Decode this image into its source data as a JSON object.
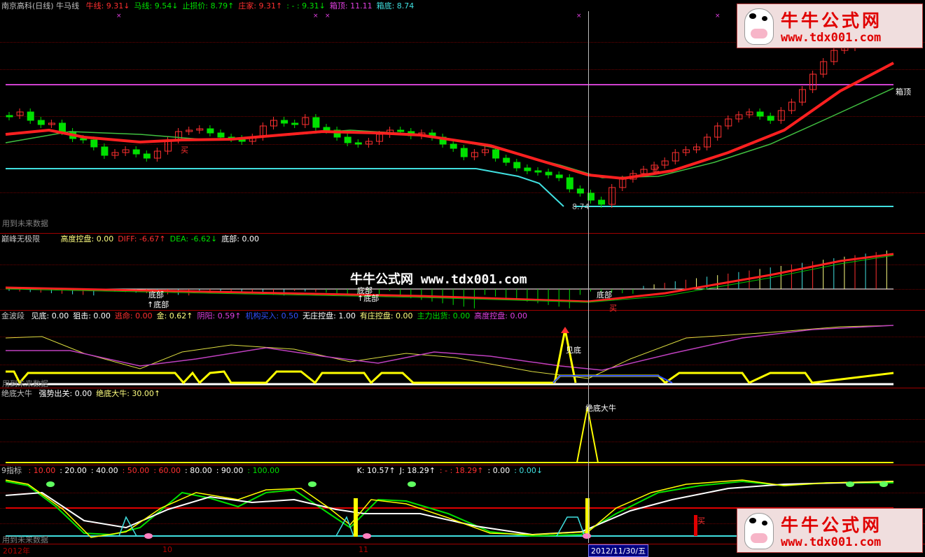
{
  "colors": {
    "red": "#ff3030",
    "green": "#00e000",
    "cyan": "#40e0e0",
    "magenta": "#e040e0",
    "yellow": "#ffff00",
    "white": "#ffffff",
    "blue": "#3050ff",
    "grid": "#8a0000"
  },
  "main": {
    "title": "南京高科(日线) 牛马线",
    "items": [
      {
        "label": "牛线: 9.31",
        "arrow": "↓",
        "color": "#ff3030"
      },
      {
        "label": "马线: 9.54",
        "arrow": "↓",
        "color": "#00e000"
      },
      {
        "label": "止损价: 8.79",
        "arrow": "↑",
        "color": "#00e000"
      },
      {
        "label": "庄家: 9.31",
        "arrow": "↑",
        "color": "#ff3030"
      },
      {
        "label": ": - : 9.31",
        "arrow": "↓",
        "color": "#00e000"
      },
      {
        "label": "箱顶: 11.11",
        "arrow": "",
        "color": "#e040e0"
      },
      {
        "label": "箱底: 8.74",
        "arrow": "",
        "color": "#40e0e0"
      }
    ],
    "box_top_label": "箱顶",
    "low_label": "8.74",
    "buy_label_1": "买",
    "buy_label_2": "买",
    "future_label": "用到未来数据"
  },
  "p2": {
    "title": "巅峰无极限",
    "items": [
      {
        "label": "高度控盘: 0.00",
        "arrow": "",
        "color": "#ffff80"
      },
      {
        "label": "DIFF: -6.67",
        "arrow": "↑",
        "color": "#ff3030"
      },
      {
        "label": "DEA: -6.62",
        "arrow": "↓",
        "color": "#00e000"
      },
      {
        "label": "底部: 0.00",
        "arrow": "",
        "color": "#ffffff"
      }
    ],
    "bottom_1": "底部",
    "bottom_2": "↑底部",
    "bottom_3": "底部",
    "bottom_4": "↑底部",
    "bottom_5": "底部",
    "bottom_6": "买"
  },
  "p3": {
    "title": "金波段",
    "items": [
      {
        "label": "见底: 0.00",
        "arrow": "",
        "color": "#ffffff"
      },
      {
        "label": "狙击: 0.00",
        "arrow": "",
        "color": "#ffffff"
      },
      {
        "label": "逃命: 0.00",
        "arrow": "",
        "color": "#ff3030"
      },
      {
        "label": "金: 0.62",
        "arrow": "↑",
        "color": "#ffff80"
      },
      {
        "label": "阴阳: 0.59",
        "arrow": "↑",
        "color": "#e040e0"
      },
      {
        "label": "机构买入: 0.50",
        "arrow": "",
        "color": "#3050ff"
      },
      {
        "label": "无庄控盘: 1.00",
        "arrow": "",
        "color": "#ffffff"
      },
      {
        "label": "有庄控盘: 0.00",
        "arrow": "",
        "color": "#ffff80"
      },
      {
        "label": "主力出货: 0.00",
        "arrow": "",
        "color": "#00e000"
      },
      {
        "label": "高度控盘: 0.00",
        "arrow": "",
        "color": "#e040e0"
      }
    ],
    "see_bottom": "见底",
    "future_label": "用到未来数据"
  },
  "p4": {
    "title": "绝底大牛",
    "items": [
      {
        "label": "强势出关: 0.00",
        "arrow": "",
        "color": "#ffffff"
      },
      {
        "label": "绝底大牛: 30.00",
        "arrow": "↑",
        "color": "#ffff80"
      }
    ],
    "peak_label": "绝底大牛"
  },
  "p5": {
    "title": "9指标",
    "items": [
      {
        "label": ": 10.00",
        "arrow": "",
        "color": "#ff3030"
      },
      {
        "label": ": 20.00",
        "arrow": "",
        "color": "#ffffff"
      },
      {
        "label": ": 40.00",
        "arrow": "",
        "color": "#ffffff"
      },
      {
        "label": ": 50.00",
        "arrow": "",
        "color": "#ff3030"
      },
      {
        "label": ": 60.00",
        "arrow": "",
        "color": "#ff3030"
      },
      {
        "label": ": 80.00",
        "arrow": "",
        "color": "#ffffff"
      },
      {
        "label": ": 90.00",
        "arrow": "",
        "color": "#ffffff"
      },
      {
        "label": ": 100.00",
        "arrow": "",
        "color": "#00e000"
      }
    ],
    "items2": [
      {
        "label": "K: 10.57",
        "arrow": "↑",
        "color": "#ffffff"
      },
      {
        "label": "J: 18.29",
        "arrow": "↑",
        "color": "#ffffff"
      },
      {
        "label": ": - : 18.29",
        "arrow": "↑",
        "color": "#ff3030"
      },
      {
        "label": ": 0.00",
        "arrow": "",
        "color": "#ffffff"
      },
      {
        "label": ": 0.00",
        "arrow": "↓",
        "color": "#40e0e0"
      }
    ],
    "buy_label": "买",
    "future_label": "用到未来数据"
  },
  "xaxis": {
    "labels": [
      "2012年",
      "10",
      "11"
    ],
    "cursor_date": "2012/11/30/五"
  },
  "watermark": {
    "title": "牛牛公式网",
    "url": "www.tdx001.com"
  },
  "center_watermark": "牛牛公式网 www.tdx001.com"
}
